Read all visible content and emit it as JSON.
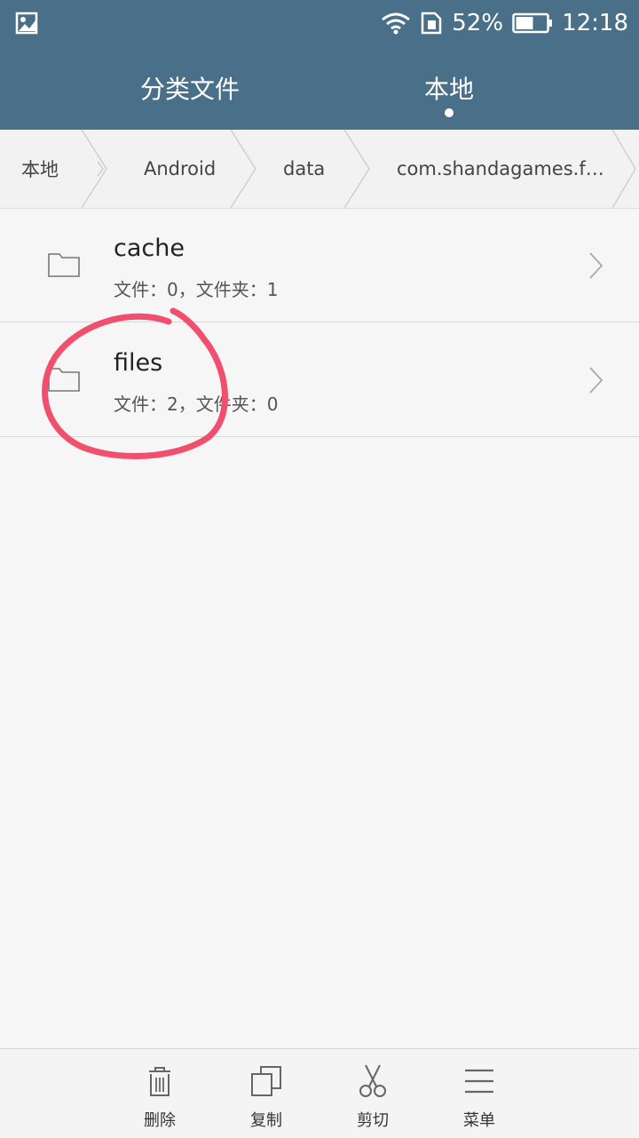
{
  "status_bar": {
    "battery_percent": "52%",
    "time": "12:18"
  },
  "tabs": [
    {
      "label": "分类文件",
      "active": false
    },
    {
      "label": "本地",
      "active": true
    }
  ],
  "breadcrumb": [
    "本地",
    "Android",
    "data",
    "com.shandagames.f…"
  ],
  "files": [
    {
      "name": "cache",
      "meta": "文件：0，文件夹：1"
    },
    {
      "name": "files",
      "meta": "文件：2，文件夹：0"
    }
  ],
  "annotation_color": "#f0506e",
  "bottom_bar": [
    {
      "label": "删除",
      "icon": "trash-icon"
    },
    {
      "label": "复制",
      "icon": "copy-icon"
    },
    {
      "label": "剪切",
      "icon": "scissors-icon"
    },
    {
      "label": "菜单",
      "icon": "menu-icon"
    }
  ]
}
